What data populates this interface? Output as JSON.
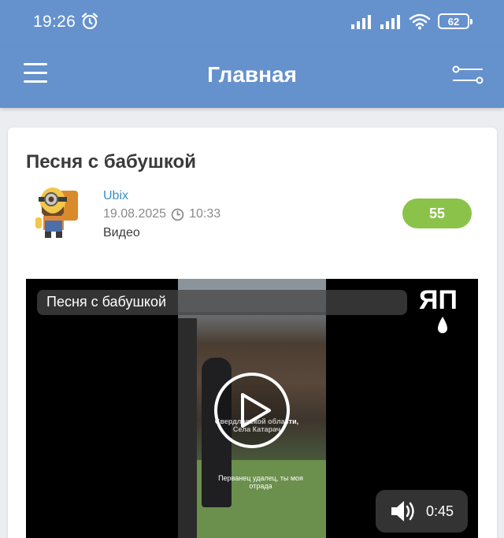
{
  "status_bar": {
    "time": "19:26",
    "battery": "62"
  },
  "app_bar": {
    "title": "Главная"
  },
  "post": {
    "title": "Песня с бабушкой",
    "author": "Ubix",
    "date": "19.08.2025",
    "time": "10:33",
    "type": "Видео",
    "rating": "55",
    "rating_color": "#8bc34a"
  },
  "video": {
    "title": "Песня с бабушкой",
    "channel_logo": "ЯП",
    "duration": "0:45",
    "caption_location": "Свердловской области, Села Катарач",
    "caption_lyrics": "Перванец удалец, ты моя отрада"
  },
  "colors": {
    "header": "#6592cd",
    "link": "#3b8fc4"
  },
  "icons": [
    "alarm-icon",
    "signal-icon",
    "wifi-icon",
    "battery-icon",
    "menu-icon",
    "filter-icon",
    "clock-icon",
    "play-icon",
    "volume-icon"
  ]
}
